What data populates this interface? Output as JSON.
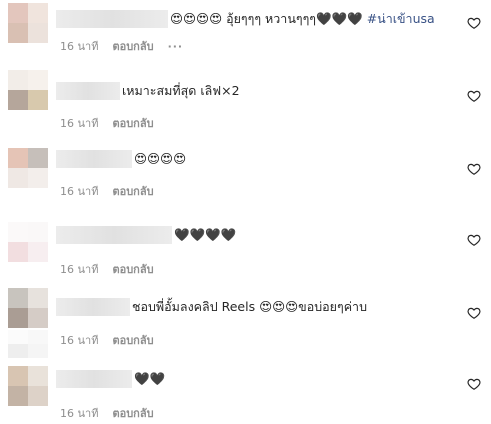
{
  "comments": [
    {
      "username": "user1",
      "text": "😍😍😍😍 อุ้ยๆๆๆ หวานๆๆๆ🖤🖤🖤",
      "tag": "#น่าเข้าusa",
      "time": "16 นาที",
      "reply": "ตอบกลับ",
      "more": "···",
      "avatar_colors": [
        "#e3c6bd",
        "#f0e4dd",
        "#d9c0b3",
        "#ece2dc"
      ],
      "redact_width": 112
    },
    {
      "username": "user2",
      "text": "เหมาะสมที่สุด เลิฟ×2",
      "tag": "",
      "time": "16 นาที",
      "reply": "ตอบกลับ",
      "avatar_colors": [
        "#f2ede8",
        "#f6f1ec",
        "#b5a69b",
        "#d8c9ad"
      ],
      "redact_width": 64
    },
    {
      "username": "user3",
      "text": "😍😍😍😍",
      "tag": "",
      "time": "16 นาที",
      "reply": "ตอบกลับ",
      "avatar_colors": [
        "#e5c4b6",
        "#c6bfba",
        "#efe8e4",
        "#f3eeeb"
      ],
      "redact_width": 76
    },
    {
      "username": "user4",
      "text": "🖤🖤🖤🖤",
      "tag": "",
      "time": "16 นาที",
      "reply": "ตอบกลับ",
      "avatar_colors": [
        "#fbf9f9",
        "#faf8f8",
        "#f2dee0",
        "#f7eef0"
      ],
      "redact_width": 116
    },
    {
      "username": "user5",
      "text": "ชอบพี่อั้มลงคลิป Reels 😍😍😍ขอบ่อยๆค่าบ",
      "tag": "",
      "time": "16 นาที",
      "reply": "ตอบกลับ",
      "avatar_colors": [
        "#c8c4be",
        "#e7e2dd",
        "#aa9d94",
        "#d5ccc6"
      ],
      "redact_width": 74
    },
    {
      "username": "user6",
      "text": "",
      "tag": "",
      "time": "16 นาที",
      "reply": "ตอบกลับ",
      "avatar_colors": [
        "#fbfbfb",
        "#f8f8f8",
        "#eeeeee",
        "#f5f5f5"
      ],
      "redact_width": 0
    },
    {
      "username": "user7",
      "text": "🖤🖤",
      "tag": "",
      "time": "16 นาที",
      "reply": "ตอบกลับ",
      "avatar_colors": [
        "#d8c5b2",
        "#e9e2da",
        "#c3b3a5",
        "#ddd2c8"
      ],
      "redact_width": 76
    }
  ],
  "icons": {
    "like": "heart-outline-icon"
  },
  "colors": {
    "text": "#262626",
    "muted": "#8e8e8e",
    "hashtag": "#385185"
  }
}
